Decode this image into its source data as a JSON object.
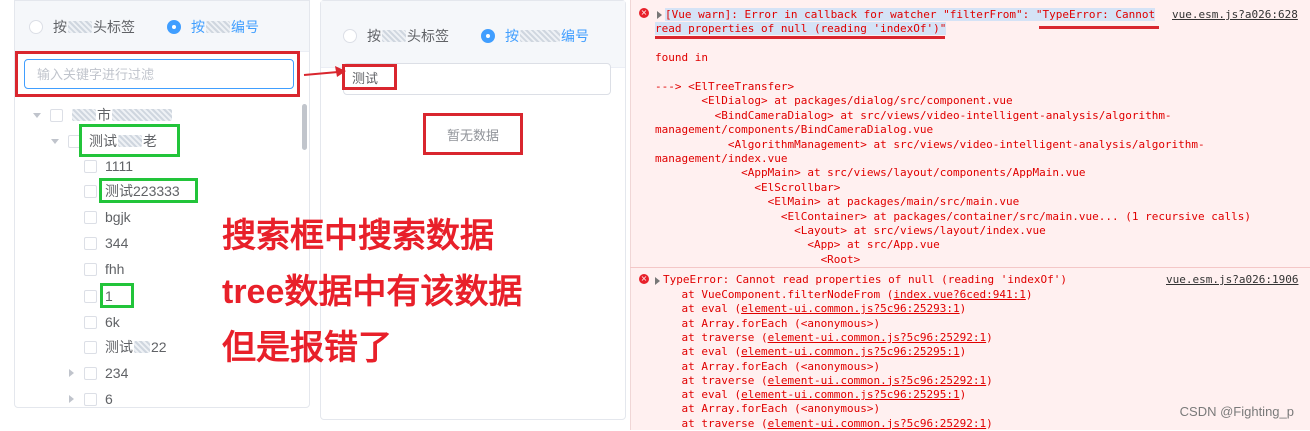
{
  "left_panel": {
    "radio1": {
      "label_a": "按",
      "label_b": "头标签"
    },
    "radio2": {
      "label_a": "按",
      "label_b": "编号"
    },
    "search_placeholder": "输入关键字进行过滤",
    "tree": {
      "root_suffix": "市",
      "group_label_a": "测试",
      "group_label_b": "老",
      "items": [
        "1111",
        "测试223333",
        "bgjk",
        "344",
        "fhh",
        "1",
        "6k"
      ],
      "item_blur_a": "测试",
      "item_blur_b": "22",
      "collapsed_items": [
        "234",
        "6"
      ]
    }
  },
  "mid_panel": {
    "radio1": {
      "label_a": "按",
      "label_b": "头标签"
    },
    "radio2": {
      "label_a": "按",
      "label_b": "编号"
    },
    "search_value": "测试",
    "empty_text": "暂无数据"
  },
  "annotation": {
    "line1": "搜索框中搜索数据",
    "line2": "tree数据中有该数据",
    "line3": "但是报错了"
  },
  "console": {
    "warn_text_1": "[Vue warn]: Error in callback for watcher \"filterFrom\": \"TypeError: Cannot",
    "warn_text_2": "read properties of null (reading 'indexOf')\"",
    "warn_link": "vue.esm.js?a026:628",
    "found_in": "found in",
    "stack": [
      "---> <ElTreeTransfer>",
      "       <ElDialog> at packages/dialog/src/component.vue",
      "         <BindCameraDialog> at src/views/video-intelligent-analysis/algorithm-",
      "management/components/BindCameraDialog.vue",
      "           <AlgorithmManagement> at src/views/video-intelligent-analysis/algorithm-",
      "management/index.vue",
      "             <AppMain> at src/views/layout/components/AppMain.vue",
      "               <ElScrollbar>",
      "                 <ElMain> at packages/main/src/main.vue",
      "                   <ElContainer> at packages/container/src/main.vue... (1 recursive calls)",
      "                     <Layout> at src/views/layout/index.vue",
      "                       <App> at src/App.vue",
      "                         <Root>"
    ],
    "error_text": "TypeError: Cannot read properties of null (reading 'indexOf')",
    "error_link": "vue.esm.js?a026:1906",
    "trace": [
      {
        "prefix": "    at VueComponent.filterNodeFrom (",
        "link": "index.vue?6ced:941:1",
        "suffix": ")"
      },
      {
        "prefix": "    at eval (",
        "link": "element-ui.common.js?5c96:25293:1",
        "suffix": ")"
      },
      {
        "prefix": "    at Array.forEach (<anonymous>)",
        "link": "",
        "suffix": ""
      },
      {
        "prefix": "    at traverse (",
        "link": "element-ui.common.js?5c96:25292:1",
        "suffix": ")"
      },
      {
        "prefix": "    at eval (",
        "link": "element-ui.common.js?5c96:25295:1",
        "suffix": ")"
      },
      {
        "prefix": "    at Array.forEach (<anonymous>)",
        "link": "",
        "suffix": ""
      },
      {
        "prefix": "    at traverse (",
        "link": "element-ui.common.js?5c96:25292:1",
        "suffix": ")"
      },
      {
        "prefix": "    at eval (",
        "link": "element-ui.common.js?5c96:25295:1",
        "suffix": ")"
      },
      {
        "prefix": "    at Array.forEach (<anonymous>)",
        "link": "",
        "suffix": ""
      },
      {
        "prefix": "    at traverse (",
        "link": "element-ui.common.js?5c96:25292:1",
        "suffix": ")"
      }
    ]
  },
  "watermark": "CSDN @Fighting_p",
  "colors": {
    "accent": "#409eff",
    "highlight_red": "#d9262e",
    "highlight_green": "#22c43a",
    "console_bg": "#fff0f0",
    "console_error": "#e00000"
  }
}
